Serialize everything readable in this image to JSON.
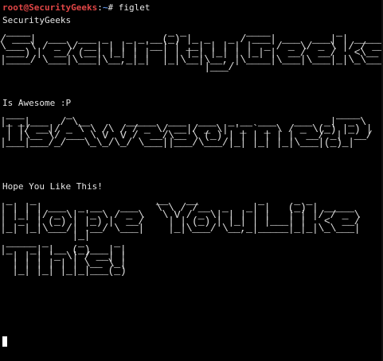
{
  "prompt": {
    "user_host": "root@SecurityGeeks",
    "separator": ":",
    "path": "~",
    "symbol": "#",
    "command": "figlet"
  },
  "output": [
    {
      "text": "SecurityGeeks",
      "art": " ____                       _ _          ____           _        \n/ ___|  ___  ___ _   _ _ __(_) |_ _   _ / ___| ___  ___| | _____ \n\\___ \\ / _ \\/ __| | | | '__| | __| | | | |  _ / _ \\/ _ \\ |/ / __|\n ___) |  __/ (__| |_| | |  | | |_| |_| | |_| |  __/  __/   <\\__ \\\n|____/ \\___|\\___|\\__,_|_|  |_|\\__|\\__, |\\____|\\___|\\___|_|\\_\\___/\n                                  |___/                          "
    },
    {
      "text": "Is Awesome :P",
      "art": " ___       _                                            ____  \n|_ _|___  / \\__      _____  ___  ___  _ __ ___   ___  _|  _ \\ \n | |/ __|/ _ \\ \\ /\\ / / _ \\/ __|/ _ \\| '_ ` _ \\ / _ \\(_) |_) |\n | |\\__ \\/ ___ \\ V  V /  __/\\__ \\ (_) | | | | | |  __/ _|  __/ \n|___|___/_/   \\_\\_/\\_/ \\___||___/\\___/|_| |_| |_|\\___|(_)_|    "
    },
    {
      "text": "Hope You Like This!",
      "art": " _   _                    __   __          _     _ _        \n| | | | ___  _ __   ___   \\ \\ / /__  _   _| |   (_) | _____ \n| |_| |/ _ \\| '_ \\ / _ \\   \\ V / _ \\| | | | |   | | |/ / _ \\\n|  _  | (_) | |_) |  __/    | | (_) | |_| | |___| |   <  __/\n|_| |_|\\___/| .__/ \\___|    |_|\\___/ \\__,_|_____|_|_|\\_\\___|\n            |_|                                             \n _____ _     _     _ \n|_   _| |__ (_)___| |\n  | | | '_ \\| / __| |\n  | | | | | | \\__ \\_|\n  |_| |_| |_|_|___(_)"
    }
  ]
}
